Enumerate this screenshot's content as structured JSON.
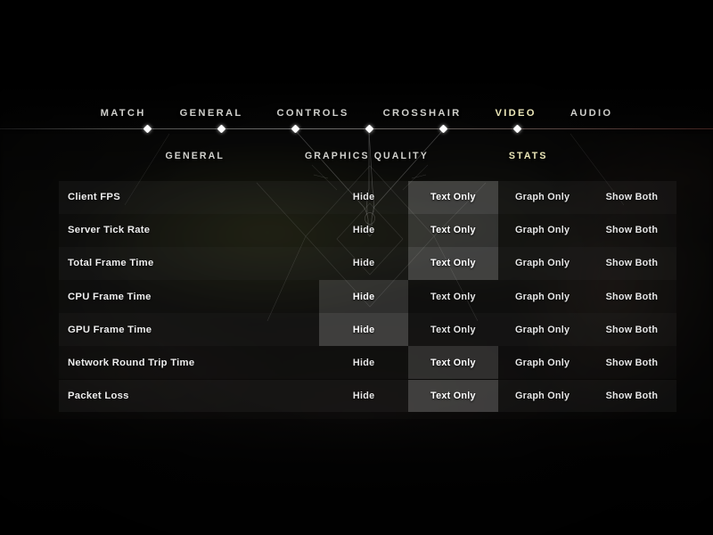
{
  "colors": {
    "accent": "#ece7b8",
    "text": "#eeeeee",
    "inactive_text": "#cfcfcb",
    "row_a": "#2a2a2a",
    "row_b": "#1c1c1c",
    "selected_cell": "#e0e0e0"
  },
  "primary_nav": {
    "items": [
      {
        "label": "MATCH",
        "active": false
      },
      {
        "label": "GENERAL",
        "active": false
      },
      {
        "label": "CONTROLS",
        "active": false
      },
      {
        "label": "CROSSHAIR",
        "active": false
      },
      {
        "label": "VIDEO",
        "active": true
      },
      {
        "label": "AUDIO",
        "active": false
      }
    ],
    "dot_positions": [
      165,
      248,
      331,
      414,
      497,
      580
    ]
  },
  "sub_nav": {
    "items": [
      {
        "label": "GENERAL",
        "active": false
      },
      {
        "label": "GRAPHICS QUALITY",
        "active": false
      },
      {
        "label": "STATS",
        "active": true
      }
    ]
  },
  "settings_table": {
    "option_labels": [
      "Hide",
      "Text Only",
      "Graph Only",
      "Show Both"
    ],
    "rows": [
      {
        "label": "Client FPS",
        "selected": 1,
        "tone": "a"
      },
      {
        "label": "Server Tick Rate",
        "selected": 1,
        "tone": "b"
      },
      {
        "label": "Total Frame Time",
        "selected": 1,
        "tone": "a"
      },
      {
        "label": "CPU Frame Time",
        "selected": 0,
        "tone": "b"
      },
      {
        "label": "GPU Frame Time",
        "selected": 0,
        "tone": "a"
      },
      {
        "label": "Network Round Trip Time",
        "selected": 1,
        "tone": "b"
      },
      {
        "label": "Packet Loss",
        "selected": 1,
        "tone": "a"
      }
    ]
  }
}
